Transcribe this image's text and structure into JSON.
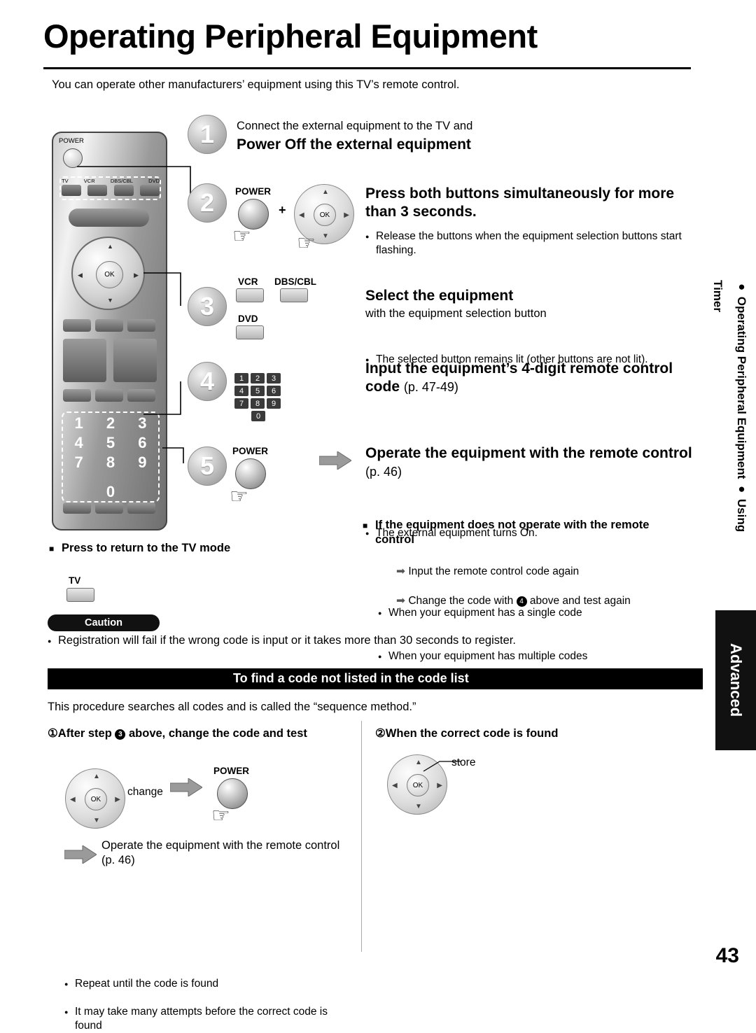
{
  "title": "Operating Peripheral Equipment",
  "intro": "You can operate other manufacturers’ equipment using this TV’s remote control.",
  "side_tab": {
    "line": "● Operating Peripheral Equipment  ● Using Timer",
    "advanced": "Advanced"
  },
  "steps": [
    {
      "num": "1",
      "lead": "Connect the external equipment to the TV and",
      "heading": "Power Off the external equipment"
    },
    {
      "num": "2",
      "heading": "Press both buttons simultaneously for more than 3 seconds.",
      "bullets": [
        "Release the buttons when the equipment selection buttons start flashing."
      ],
      "graphic_labels": {
        "power": "POWER",
        "plus": "+",
        "ok": "OK"
      }
    },
    {
      "num": "3",
      "heading": "Select the equipment",
      "sub": "with the equipment selection button",
      "bullets": [
        "The selected button remains lit (other buttons are not lit)."
      ],
      "graphic_labels": {
        "vcr": "VCR",
        "dbscbl": "DBS/CBL",
        "dvd": "DVD"
      }
    },
    {
      "num": "4",
      "heading": "Input the equipment’s 4-digit remote control code",
      "heading_ref": "(p. 47-49)",
      "keys": [
        "1",
        "2",
        "3",
        "4",
        "5",
        "6",
        "7",
        "8",
        "9"
      ],
      "key_zero": "0"
    },
    {
      "num": "5",
      "heading": "Operate the equipment with the remote control",
      "heading_ref": "(p. 46)",
      "bullets": [
        "The external equipment turns On."
      ],
      "graphic_labels": {
        "power": "POWER"
      }
    }
  ],
  "return_tv": {
    "heading": "Press to return to the TV mode",
    "button_label": "TV"
  },
  "not_operate": {
    "heading": "If the equipment does not operate with the remote control",
    "items": [
      {
        "bullet": "When your equipment has a single code",
        "arrow": "Input the remote control code again"
      },
      {
        "bullet": "When your equipment has multiple codes",
        "arrow_pre": "Change the code with",
        "arrow_circle": "4",
        "arrow_post": "above and test again"
      }
    ]
  },
  "caution": {
    "label": "Caution",
    "text": "Registration will fail if the wrong code is input or it takes more than 30 seconds to register."
  },
  "code_section": {
    "bar_title": "To find a code not listed in the code list",
    "intro": "This procedure searches all codes and is called the “sequence method.”",
    "left": {
      "num": "①",
      "heading_pre": "After step",
      "heading_circle": "3",
      "heading_post": "above, change the code and test",
      "change_label": "change",
      "power_label": "POWER",
      "ok_label": "OK",
      "result": "Operate the equipment with the remote control (p. 46)",
      "notes": [
        "Repeat until the code is found",
        "It may take many attempts before the correct code is found"
      ]
    },
    "right": {
      "num": "②",
      "heading": "When the correct code is found",
      "store_label": "store",
      "ok_label": "OK"
    }
  },
  "remote": {
    "power_label": "POWER",
    "selection_labels": [
      "TV",
      "VCR",
      "DBS/CBL",
      "DVD"
    ],
    "ok_label": "OK",
    "numbers": [
      "1",
      "2",
      "3",
      "4",
      "5",
      "6",
      "7",
      "8",
      "9"
    ],
    "zero": "0"
  },
  "page_number": "43"
}
